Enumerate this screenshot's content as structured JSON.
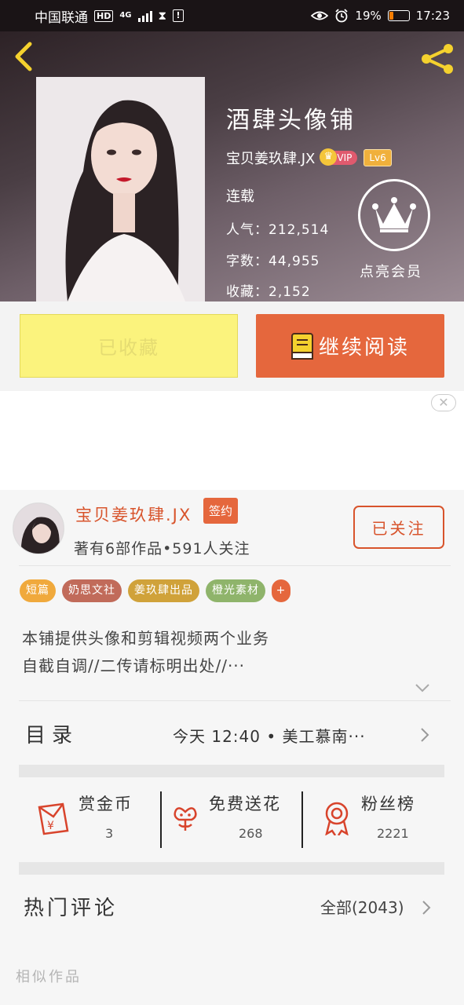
{
  "status_bar": {
    "carrier": "中国联通",
    "hd": "HD",
    "network": "4G",
    "battery": "19%",
    "battery_level": 0.19,
    "time": "17:23"
  },
  "header": {
    "book_title": "酒肆头像铺",
    "author": "宝贝姜玖肆.JX",
    "vip": "VIP",
    "level": "Lv6",
    "status": "连载",
    "popularity": "人气：212,514",
    "word_count": "字数：44,955",
    "favorites": "收藏：2,152",
    "member_label": "点亮会员"
  },
  "actions": {
    "saved_label": "已收藏",
    "read_label": "继续阅读"
  },
  "author_section": {
    "name": "宝贝姜玖肆.JX",
    "sign_badge": "签约",
    "meta": "著有6部作品•591人关注",
    "follow_label": "已关注",
    "tags": [
      {
        "label": "短篇",
        "color": "#f0a93c"
      },
      {
        "label": "奶思文社",
        "color": "#c16b5a"
      },
      {
        "label": "姜玖肆出品",
        "color": "#d0a23a"
      },
      {
        "label": "橙光素材",
        "color": "#8fb46b"
      },
      {
        "label": "+",
        "color": "#e5673d"
      }
    ],
    "description_line1": "本铺提供头像和剪辑视频两个业务",
    "description_line2": "自截自调//二传请标明出处//···"
  },
  "toc": {
    "label": "目录",
    "latest": "今天 12:40 • 美工慕南···"
  },
  "stats": {
    "coins_label": "赏金币",
    "coins_value": "3",
    "flowers_label": "免费送花",
    "flowers_value": "268",
    "fans_label": "粉丝榜",
    "fans_value": "2221"
  },
  "comments": {
    "label": "热门评论",
    "all": "全部(2043)"
  },
  "similar": {
    "label": "相似作品"
  },
  "colors": {
    "accent": "#e5673d",
    "author_red": "#d8542c",
    "saved_yellow": "#fbf37d",
    "back_yellow": "#f4d12e"
  }
}
